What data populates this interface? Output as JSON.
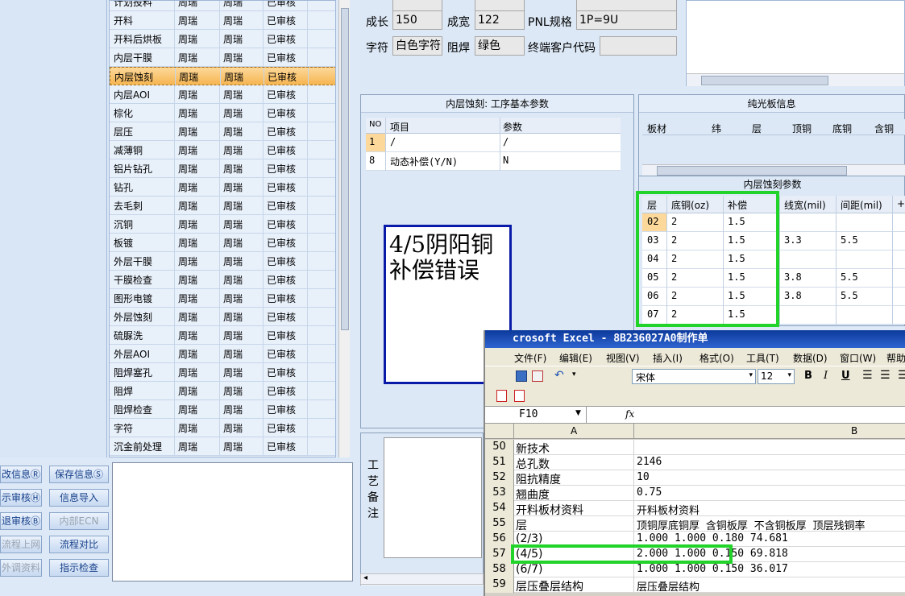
{
  "process_list": {
    "rows": [
      {
        "name": "计划投料",
        "user": "周瑞",
        "user2": "周瑞",
        "status": "已审核"
      },
      {
        "name": "开料",
        "user": "周瑞",
        "user2": "周瑞",
        "status": "已审核"
      },
      {
        "name": "开料后烘板",
        "user": "周瑞",
        "user2": "周瑞",
        "status": "已审核"
      },
      {
        "name": "内层干膜",
        "user": "周瑞",
        "user2": "周瑞",
        "status": "已审核"
      },
      {
        "name": "内层蚀刻",
        "user": "周瑞",
        "user2": "周瑞",
        "status": "已审核",
        "selected": true
      },
      {
        "name": "内层AOI",
        "user": "周瑞",
        "user2": "周瑞",
        "status": "已审核"
      },
      {
        "name": "棕化",
        "user": "周瑞",
        "user2": "周瑞",
        "status": "已审核"
      },
      {
        "name": "层压",
        "user": "周瑞",
        "user2": "周瑞",
        "status": "已审核"
      },
      {
        "name": "减薄铜",
        "user": "周瑞",
        "user2": "周瑞",
        "status": "已审核"
      },
      {
        "name": "铝片钻孔",
        "user": "周瑞",
        "user2": "周瑞",
        "status": "已审核"
      },
      {
        "name": "钻孔",
        "user": "周瑞",
        "user2": "周瑞",
        "status": "已审核"
      },
      {
        "name": "去毛刺",
        "user": "周瑞",
        "user2": "周瑞",
        "status": "已审核"
      },
      {
        "name": "沉铜",
        "user": "周瑞",
        "user2": "周瑞",
        "status": "已审核"
      },
      {
        "name": "板镀",
        "user": "周瑞",
        "user2": "周瑞",
        "status": "已审核"
      },
      {
        "name": "外层干膜",
        "user": "周瑞",
        "user2": "周瑞",
        "status": "已审核"
      },
      {
        "name": "干膜检查",
        "user": "周瑞",
        "user2": "周瑞",
        "status": "已审核"
      },
      {
        "name": "图形电镀",
        "user": "周瑞",
        "user2": "周瑞",
        "status": "已审核"
      },
      {
        "name": "外层蚀刻",
        "user": "周瑞",
        "user2": "周瑞",
        "status": "已审核"
      },
      {
        "name": "硫脲洗",
        "user": "周瑞",
        "user2": "周瑞",
        "status": "已审核"
      },
      {
        "name": "外层AOI",
        "user": "周瑞",
        "user2": "周瑞",
        "status": "已审核"
      },
      {
        "name": "阻焊塞孔",
        "user": "周瑞",
        "user2": "周瑞",
        "status": "已审核"
      },
      {
        "name": "阻焊",
        "user": "周瑞",
        "user2": "周瑞",
        "status": "已审核"
      },
      {
        "name": "阻焊检查",
        "user": "周瑞",
        "user2": "周瑞",
        "status": "已审核"
      },
      {
        "name": "字符",
        "user": "周瑞",
        "user2": "周瑞",
        "status": "已审核"
      },
      {
        "name": "沉金前处理",
        "user": "周瑞",
        "user2": "周瑞",
        "status": "已审核"
      }
    ]
  },
  "left_buttons": {
    "col1": [
      "改信息Ⓡ",
      "示审核Ⓗ",
      "退审核Ⓑ",
      "流程上网",
      "外调资料"
    ],
    "col2": [
      "保存信息Ⓢ",
      "信息导入",
      "内部ECN",
      "流程对比",
      "指示检查"
    ]
  },
  "top_form": {
    "growth_label": "成长",
    "growth_value": "150",
    "width_label": "成宽",
    "width_value": "122",
    "pnl_label": "PNL规格",
    "pnl_value": "1P=9U",
    "char_label": "字符",
    "char_value": "白色字符",
    "mask_label": "阻焊",
    "mask_value": "绿色",
    "customer_label": "终端客户代码",
    "customer_value": ""
  },
  "basic_params": {
    "title": "内层蚀刻: 工序基本参数",
    "headers": [
      "NO",
      "项目",
      "参数"
    ],
    "rows": [
      {
        "no": "1",
        "item": "/",
        "param": "/"
      },
      {
        "no": "8",
        "item": "动态补偿(Y/N)",
        "param": "N"
      }
    ]
  },
  "craft_notes_label": [
    "工",
    "艺",
    "备",
    "注"
  ],
  "bare_board": {
    "title": "纯光板信息",
    "headers": [
      "板材",
      "纬",
      "层",
      "顶铜",
      "底铜",
      "含铜"
    ]
  },
  "etch_params": {
    "title": "内层蚀刻参数",
    "headers": [
      "层",
      "底铜(oz)",
      "补偿",
      "线宽(mil)",
      "间距(mil)",
      "+"
    ],
    "rows": [
      {
        "layer": "02",
        "base": "2",
        "comp": "1.5",
        "width": "",
        "space": ""
      },
      {
        "layer": "03",
        "base": "2",
        "comp": "1.5",
        "width": "3.3",
        "space": "5.5"
      },
      {
        "layer": "04",
        "base": "2",
        "comp": "1.5",
        "width": "",
        "space": ""
      },
      {
        "layer": "05",
        "base": "2",
        "comp": "1.5",
        "width": "3.8",
        "space": "5.5"
      },
      {
        "layer": "06",
        "base": "2",
        "comp": "1.5",
        "width": "3.8",
        "space": "5.5"
      },
      {
        "layer": "07",
        "base": "2",
        "comp": "1.5",
        "width": "",
        "space": ""
      }
    ]
  },
  "annotation": {
    "line1": "4/5阴阳铜",
    "line2": "补偿错误"
  },
  "excel": {
    "title": "crosoft Excel - 8B236027A0制作单",
    "menu": [
      "文件(F)",
      "编辑(E)",
      "视图(V)",
      "插入(I)",
      "格式(O)",
      "工具(T)",
      "数据(D)",
      "窗口(W)",
      "帮助"
    ],
    "font_name": "宋体",
    "font_size": "12",
    "cell_ref": "F10",
    "fx": "fx",
    "col_a": "A",
    "col_b": "B",
    "rows": [
      {
        "n": "50",
        "a": "新技术",
        "b": ""
      },
      {
        "n": "51",
        "a": "总孔数",
        "b": "2146"
      },
      {
        "n": "52",
        "a": "阻抗精度",
        "b": "10"
      },
      {
        "n": "53",
        "a": "翘曲度",
        "b": "0.75"
      },
      {
        "n": "54",
        "a": "开料板材资料",
        "b": "开料板材资料"
      },
      {
        "n": "55",
        "a": "层",
        "b": "顶铜厚底铜厚 含铜板厚 不含铜板厚 顶层残铜率"
      },
      {
        "n": "56",
        "a": "(2/3)",
        "b": "1.000  1.000            0.180       74.681"
      },
      {
        "n": "57",
        "a": "(4/5)",
        "b": "2.000  1.000            0.150       69.818"
      },
      {
        "n": "58",
        "a": "(6/7)",
        "b": "1.000  1.000            0.150       36.017"
      },
      {
        "n": "59",
        "a": "层压叠层结构",
        "b": "层压叠层结构"
      }
    ]
  },
  "colors": {
    "highlight": "#22d42a",
    "note_border": "#0a1aa8",
    "selected_row": "#f6b551"
  }
}
